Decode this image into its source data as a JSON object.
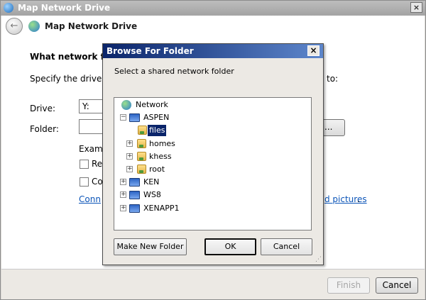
{
  "main_window": {
    "title": "Map Network Drive",
    "close_glyph": "×",
    "header_title": "Map Network Drive",
    "back_glyph": "←",
    "heading_visible": "What network folde",
    "specify_visible": "Specify the drive lett",
    "specify_tail": "to:",
    "drive_label": "Drive:",
    "drive_value": "Y:",
    "folder_label": "Folder:",
    "browse_label": "...",
    "example_visible": "Examp",
    "checkbox1_visible": "Re",
    "checkbox2_visible": "Co",
    "link_visible_left": "Conn",
    "link_visible_right": "d pictures",
    "link_trailing": ".",
    "finish_label": "Finish",
    "cancel_label": "Cancel"
  },
  "dialog": {
    "title": "Browse For Folder",
    "close_glyph": "×",
    "prompt": "Select a shared network folder",
    "tree": [
      {
        "label": "Network",
        "icon": "network-icon",
        "level": 0,
        "expander": ""
      },
      {
        "label": "ASPEN",
        "icon": "computer-icon",
        "level": 1,
        "expander": "−"
      },
      {
        "label": "files",
        "icon": "shared-folder-icon",
        "level": 2,
        "expander": "",
        "selected": true
      },
      {
        "label": "homes",
        "icon": "shared-folder-icon",
        "level": 2,
        "expander": "+"
      },
      {
        "label": "khess",
        "icon": "shared-folder-icon",
        "level": 2,
        "expander": "+"
      },
      {
        "label": "root",
        "icon": "shared-folder-icon",
        "level": 2,
        "expander": "+"
      },
      {
        "label": "KEN",
        "icon": "computer-icon",
        "level": 1,
        "expander": "+"
      },
      {
        "label": "WS8",
        "icon": "computer-icon",
        "level": 1,
        "expander": "+"
      },
      {
        "label": "XENAPP1",
        "icon": "computer-icon",
        "level": 1,
        "expander": "+"
      }
    ],
    "make_new_folder_label": "Make New Folder",
    "ok_label": "OK",
    "cancel_label": "Cancel",
    "resize_glyph": "⋰"
  },
  "colors": {
    "dialog_title_start": "#0a246a",
    "dialog_title_end": "#5e87cc",
    "link": "#0b54b8",
    "selection": "#0a246a"
  }
}
